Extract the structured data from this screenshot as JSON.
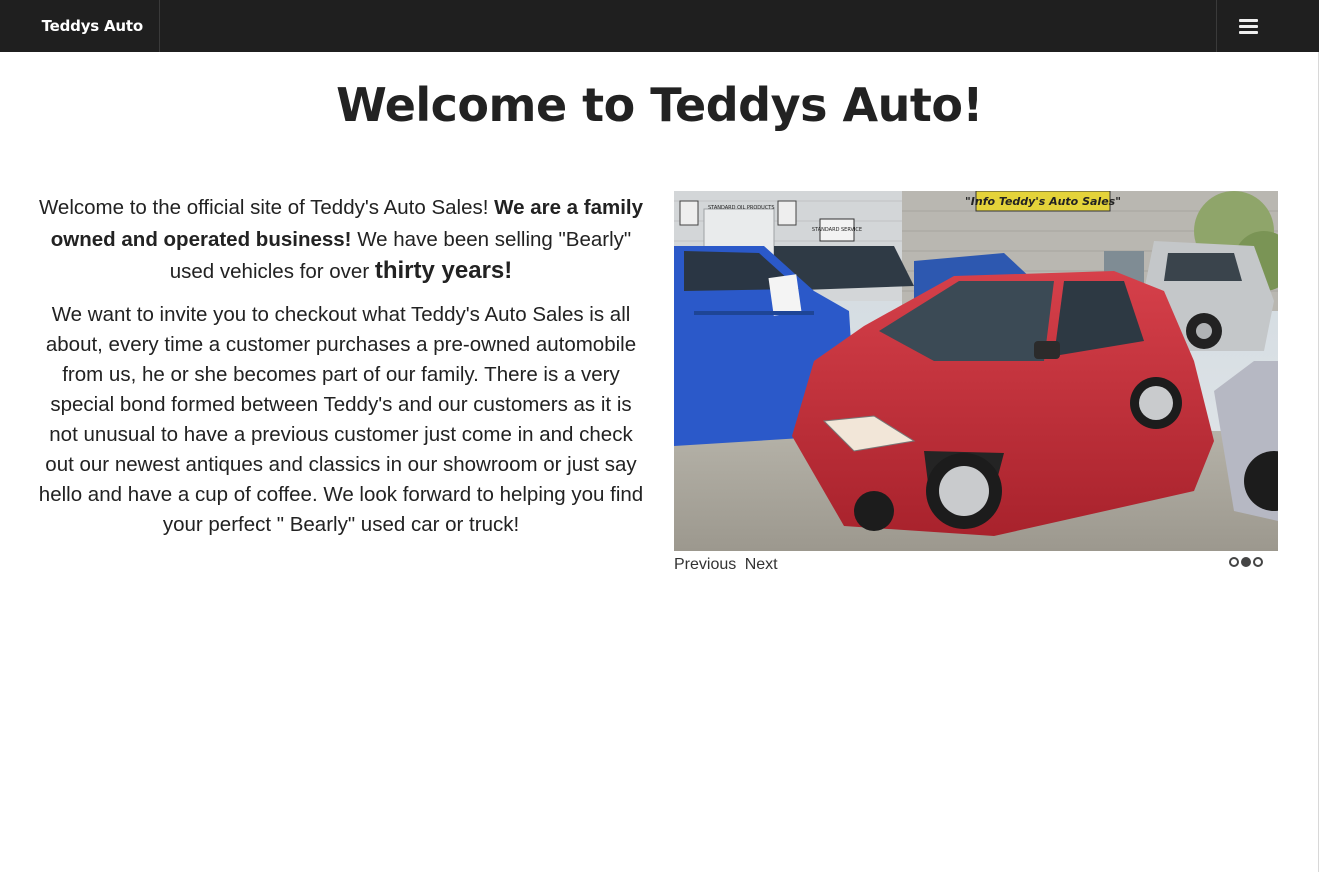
{
  "header": {
    "brand": "Teddys Auto",
    "menu_icon": "hamburger-menu-icon"
  },
  "main": {
    "title": "Welcome to Teddys Auto!",
    "intro": {
      "p1_text1": "Welcome to the official site of Teddy's Auto Sales! ",
      "p1_bold": "We are a family owned and operated business!",
      "p1_text2": " We have been selling \"Bearly\" used vehicles for over ",
      "p1_big": "thirty years!",
      "p2": "We want to invite you to checkout what Teddy's Auto Sales is all about, every time a customer purchases a pre-owned automobile from us, he or she becomes part of our family. There is a very special bond formed between Teddy's and our customers as it is not unusual to have a previous customer just come in and check out our newest antiques and classics in our showroom or just say hello and have a cup of coffee. We look forward to helping you find your perfect \" Bearly\" used car or truck!"
    },
    "slider": {
      "shop_sign": "\"Info Teddy's Auto Sales\"",
      "building_sign_1": "STANDARD OIL PRODUCTS",
      "building_sign_2": "STANDARD SERVICE",
      "prev_label": "Previous",
      "next_label": "Next",
      "slide_count": 3,
      "active_slide": 2
    }
  }
}
